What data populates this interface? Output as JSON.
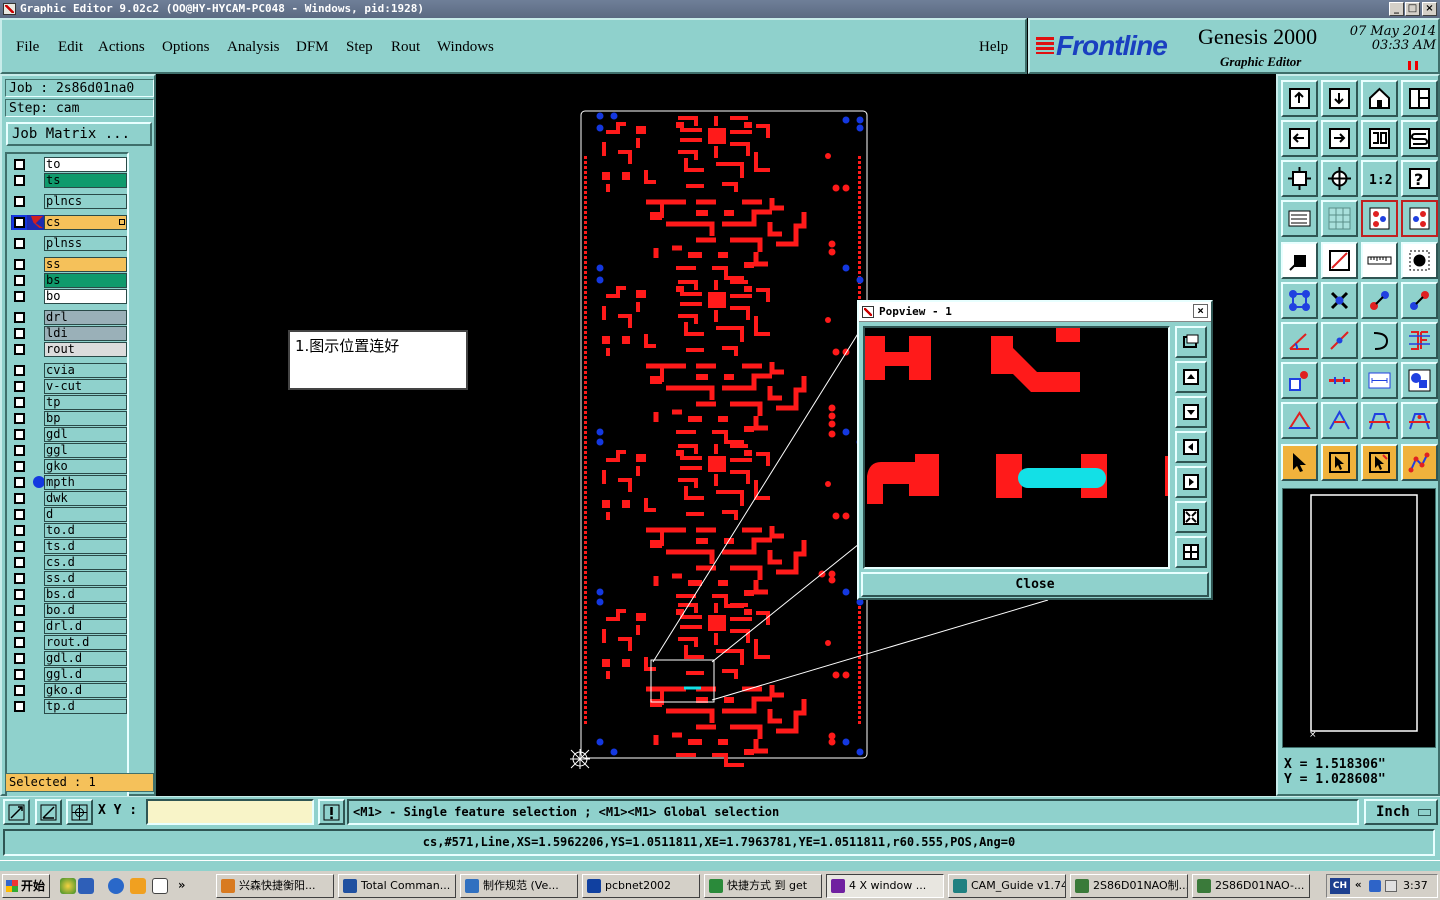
{
  "window": {
    "title": "Graphic Editor 9.02c2 (OO@HY-HYCAM-PC048 - Windows, pid:1928)",
    "controls": [
      "_",
      "□",
      "×"
    ]
  },
  "menu": {
    "items": [
      "File",
      "Edit",
      "Actions",
      "Options",
      "Analysis",
      "DFM",
      "Step",
      "Rout",
      "Windows"
    ],
    "help": "Help"
  },
  "brand": {
    "logo": "Frontline",
    "product": "Genesis 2000",
    "subtitle": "Graphic Editor",
    "date": "07 May 2014",
    "time": "03:33 AM",
    "logo_color": "#1a3fc0"
  },
  "job": {
    "job_line": "Job : 2s86d01na0",
    "step_line": "Step: cam",
    "matrix_button": "Job Matrix ..."
  },
  "layers": [
    {
      "name": "to",
      "color": "#ffffff"
    },
    {
      "name": "ts",
      "color": "#0f9a6c"
    },
    {
      "name": "plncs",
      "color": "#8fd1cc"
    },
    {
      "name": "cs",
      "color": "#f5c15a",
      "work": true
    },
    {
      "name": "plnss",
      "color": "#8fd1cc"
    },
    {
      "name": "ss",
      "color": "#f5c15a"
    },
    {
      "name": "bs",
      "color": "#0f9a6c"
    },
    {
      "name": "bo",
      "color": "#ffffff"
    },
    {
      "name": "drl",
      "color": "#9ab0b8"
    },
    {
      "name": "ldi",
      "color": "#9ab0b8"
    },
    {
      "name": "rout",
      "color": "#dcdcdc"
    },
    {
      "name": "cvia",
      "color": "#8fd1cc"
    },
    {
      "name": "v-cut",
      "color": "#8fd1cc"
    },
    {
      "name": "tp",
      "color": "#8fd1cc"
    },
    {
      "name": "bp",
      "color": "#8fd1cc"
    },
    {
      "name": "gdl",
      "color": "#8fd1cc"
    },
    {
      "name": "ggl",
      "color": "#8fd1cc"
    },
    {
      "name": "gko",
      "color": "#8fd1cc"
    },
    {
      "name": "mpth",
      "color": "#8fd1cc",
      "dot": "#1438e0"
    },
    {
      "name": "dwk",
      "color": "#8fd1cc"
    },
    {
      "name": "d",
      "color": "#8fd1cc"
    },
    {
      "name": "to.d",
      "color": "#8fd1cc"
    },
    {
      "name": "ts.d",
      "color": "#8fd1cc"
    },
    {
      "name": "cs.d",
      "color": "#8fd1cc"
    },
    {
      "name": "ss.d",
      "color": "#8fd1cc"
    },
    {
      "name": "bs.d",
      "color": "#8fd1cc"
    },
    {
      "name": "bo.d",
      "color": "#8fd1cc"
    },
    {
      "name": "drl.d",
      "color": "#8fd1cc"
    },
    {
      "name": "rout.d",
      "color": "#8fd1cc"
    },
    {
      "name": "gdl.d",
      "color": "#8fd1cc"
    },
    {
      "name": "ggl.d",
      "color": "#8fd1cc"
    },
    {
      "name": "gko.d",
      "color": "#8fd1cc"
    },
    {
      "name": "tp.d",
      "color": "#8fd1cc"
    }
  ],
  "selected": "Selected : 1",
  "annotation": "1.图示位置连好",
  "popview": {
    "title": "Popview - 1",
    "close": "Close"
  },
  "coords": {
    "x": "X = 1.518306\"",
    "y": "Y = 1.028608\""
  },
  "command": {
    "xy_label": "X Y :",
    "xy_value": "",
    "hint": "<M1> - Single feature selection ; <M1><M1> Global selection",
    "unit": "Inch"
  },
  "status": "cs,#571,Line,XS=1.5962206,YS=1.0511811,XE=1.7963781,YE=1.0511811,r60.555,POS,Ang=0",
  "colors": {
    "panel": "#8fd1cc",
    "copper": "#ff1a1a",
    "via": "#1438e0",
    "selected_feature": "#13e0e6"
  },
  "taskbar": {
    "start": "开始",
    "tasks": [
      "兴森快捷衡阳...",
      "Total Comman...",
      "制作规范 (Ve...",
      "pcbnet2002",
      "快捷方式 到 get",
      "4 X window ...",
      "CAM_Guide v1.74",
      "2S86D01NAO制...",
      "2S86D01NAO-..."
    ],
    "ime": "CH",
    "clock": "3:37"
  }
}
